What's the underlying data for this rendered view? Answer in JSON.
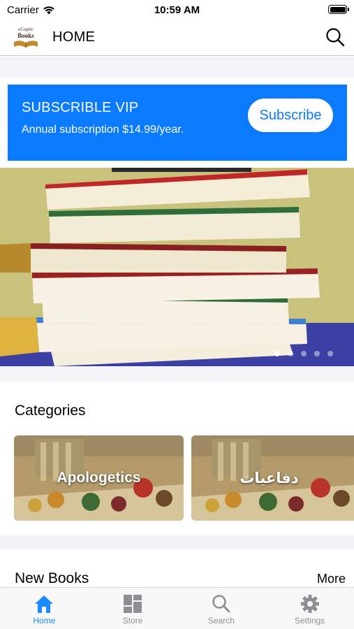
{
  "status_bar": {
    "carrier": "Carrier",
    "time": "10:59 AM"
  },
  "navbar": {
    "logo_text": "eCoptic Books",
    "title": "HOME"
  },
  "vip": {
    "title": "SUBSCRIBLE VIP",
    "subtitle": "Annual subscription $14.99/year.",
    "button_label": "Subscribe",
    "color": "#0a7bff"
  },
  "hero": {
    "slide_count": 5,
    "active_slide": 1
  },
  "categories": {
    "title": "Categories",
    "items": [
      {
        "label": "Apologetics"
      },
      {
        "label": "دفاعيات"
      }
    ]
  },
  "new_books": {
    "title": "New Books",
    "more_label": "More"
  },
  "tabs": [
    {
      "label": "Home",
      "icon": "home-icon",
      "active": true
    },
    {
      "label": "Store",
      "icon": "store-icon",
      "active": false
    },
    {
      "label": "Search",
      "icon": "search-icon",
      "active": false
    },
    {
      "label": "Settings",
      "icon": "gear-icon",
      "active": false
    }
  ]
}
